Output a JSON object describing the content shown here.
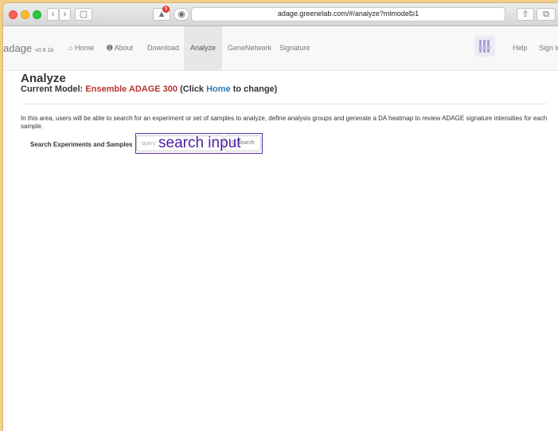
{
  "browser": {
    "url": "adage.greenelab.com/#/analyze?mlmodel=1",
    "notification_count": "9"
  },
  "navbar": {
    "brand": "adage",
    "version": "v0.8.1b",
    "items": [
      {
        "label": "Home",
        "icon": "home-icon"
      },
      {
        "label": "About",
        "icon": "info-icon"
      },
      {
        "label": "Download"
      },
      {
        "label": "Analyze",
        "active": true
      },
      {
        "label": "GeneNetwork"
      },
      {
        "label": "Signature"
      }
    ],
    "help_label": "Help",
    "signin_label": "Sign in"
  },
  "page": {
    "title": "Analyze",
    "model_prefix": "Current Model: ",
    "model_name": "Ensemble ADAGE 300",
    "model_click": " (Click ",
    "model_home_link": "Home",
    "model_suffix": " to change)",
    "description": "In this area, users will be able to search for an experiment or set of samples to analyze, define analysis groups and generate a DA heatmap to review ADAGE signature intensities for each sample.",
    "search_label": "Search Experiments and Samples",
    "search_placeholder": "query",
    "search_button": "Search"
  },
  "annotation": {
    "label": "search input",
    "color": "#5b2cb0"
  }
}
